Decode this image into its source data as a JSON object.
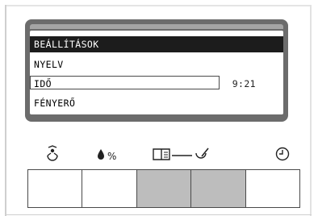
{
  "menu": {
    "items": [
      {
        "label": "BEÁLLÍTÁSOK",
        "selected": true
      },
      {
        "label": "NYELV"
      },
      {
        "label": "IDŐ",
        "value": "9:21",
        "boxed": true
      },
      {
        "label": "FÉNYERŐ"
      }
    ]
  },
  "icons": [
    "thermostat-person-icon",
    "humidity-percent-icon",
    "book-manual-icon",
    "tap-confirm-icon",
    "clock-icon"
  ],
  "icon_text": {
    "percent": "%"
  },
  "button_fills": [
    "white",
    "white",
    "grey",
    "grey",
    "white"
  ]
}
